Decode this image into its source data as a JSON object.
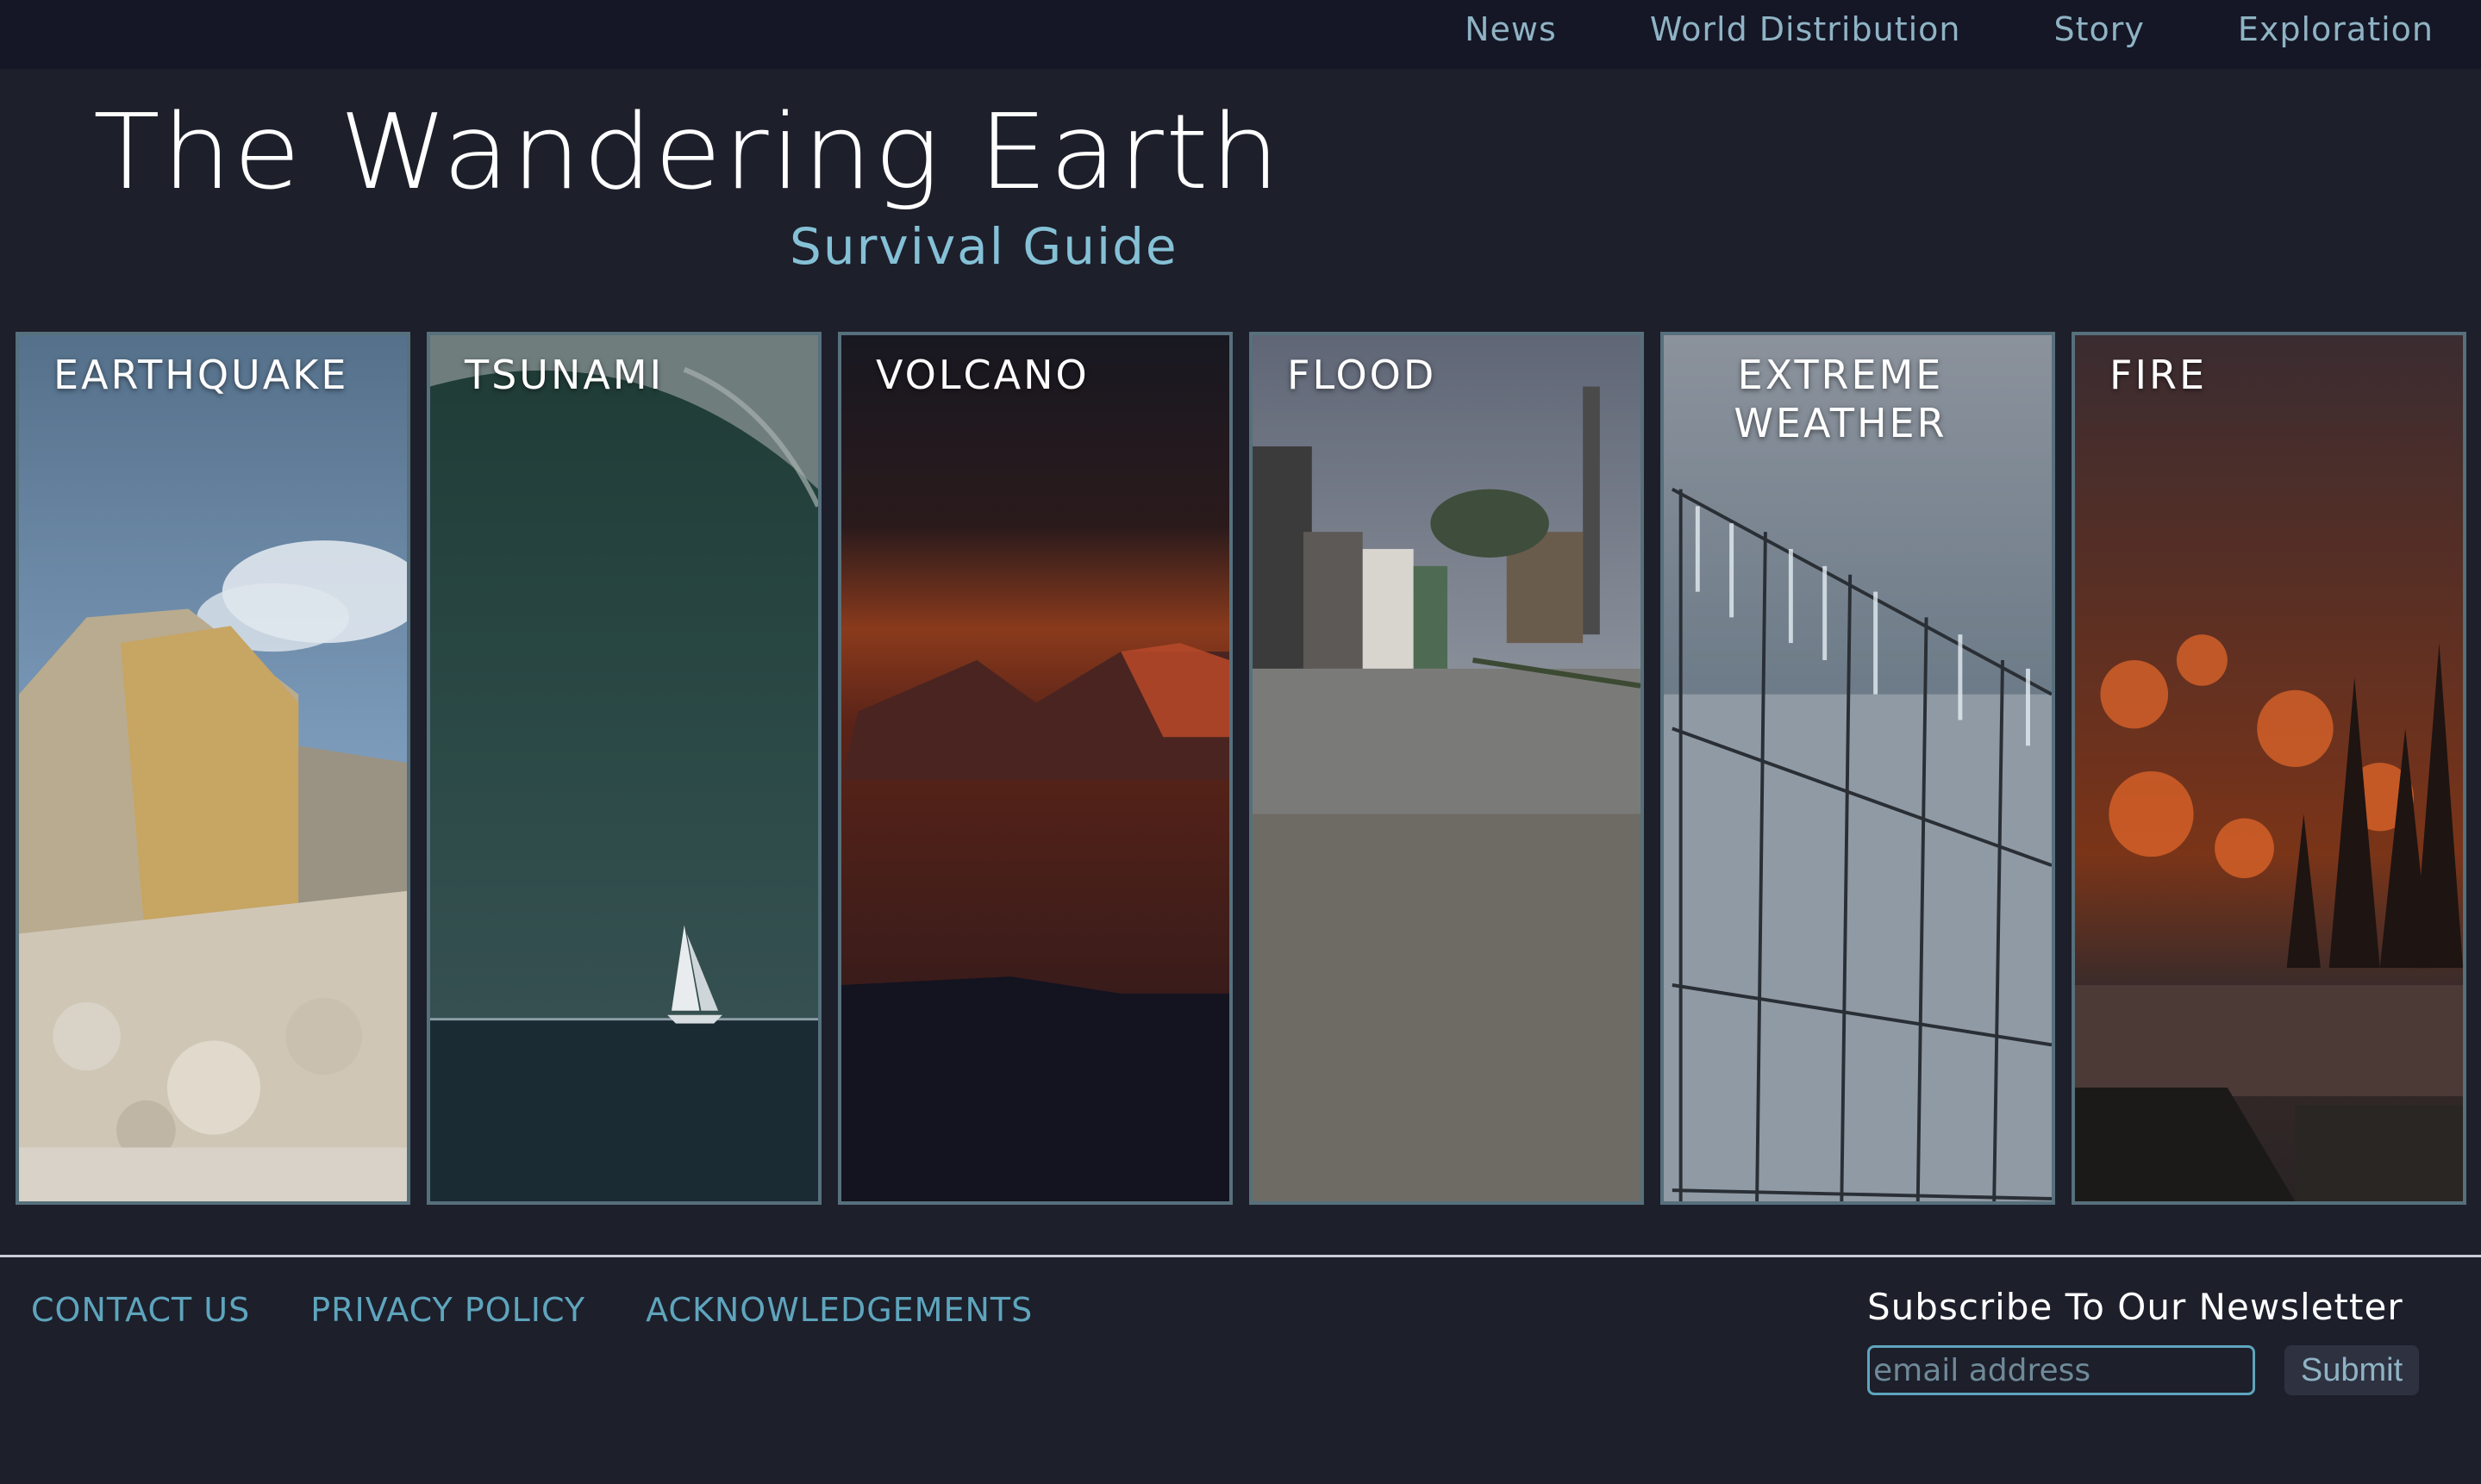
{
  "nav": {
    "items": [
      {
        "label": "News"
      },
      {
        "label": "World Distribution"
      },
      {
        "label": "Story"
      },
      {
        "label": "Exploration"
      }
    ]
  },
  "header": {
    "title": "The Wandering Earth",
    "subtitle": "Survival Guide"
  },
  "cards": [
    {
      "label": "EARTHQUAKE"
    },
    {
      "label": "TSUNAMI"
    },
    {
      "label": "VOLCANO"
    },
    {
      "label": "FLOOD"
    },
    {
      "label": "EXTREME WEATHER"
    },
    {
      "label": "FIRE"
    }
  ],
  "footer": {
    "links": [
      {
        "label": "CONTACT US"
      },
      {
        "label": "PRIVACY POLICY"
      },
      {
        "label": "ACKNOWLEDGEMENTS"
      }
    ],
    "newsletter": {
      "title": "Subscribe To Our Newsletter",
      "email_placeholder": "email address",
      "email_value": "",
      "submit_label": "Submit"
    }
  },
  "colors": {
    "background": "#1d1f2b",
    "topbar": "#151726",
    "nav_text": "#8fb3c4",
    "subtitle": "#85c1d6",
    "card_border": "#56707c",
    "footer_link": "#5ea5bd"
  }
}
